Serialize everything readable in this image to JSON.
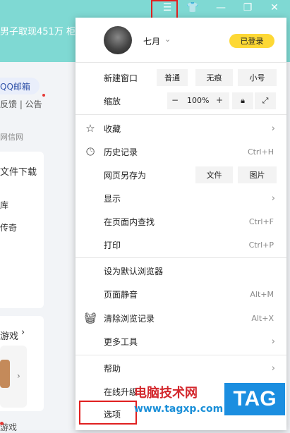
{
  "titlebar": {
    "menu_icon": "hamburger-icon",
    "skin_icon": "shirt-icon",
    "minimize_icon": "minimize-icon",
    "restore_icon": "restore-icon",
    "close_icon": "close-icon"
  },
  "background": {
    "banner_text": "男子取现451万 柜",
    "mail_chip": "QQ邮箱",
    "links": "反馈 | 公告",
    "net_label": "网信网",
    "download_heading": "文件下载",
    "item1": "库",
    "item2": "传奇",
    "games_heading": "游戏",
    "games_footer": "游戏"
  },
  "menu": {
    "user": {
      "name": "七月",
      "status_button": "已登录"
    },
    "new_window": {
      "label": "新建窗口",
      "options": [
        "普通",
        "无痕",
        "小号"
      ]
    },
    "zoom": {
      "label": "缩放",
      "minus": "−",
      "value": "100%",
      "plus": "+"
    },
    "items": {
      "favorites": "收藏",
      "history": "历史记录",
      "history_shortcut": "Ctrl+H",
      "save_as": "网页另存为",
      "save_file": "文件",
      "save_image": "图片",
      "display": "显示",
      "find": "在页面内查找",
      "find_shortcut": "Ctrl+F",
      "print": "打印",
      "print_shortcut": "Ctrl+P",
      "default_browser": "设为默认浏览器",
      "mute": "页面静音",
      "mute_shortcut": "Alt+M",
      "clear": "清除浏览记录",
      "clear_shortcut": "Alt+X",
      "more_tools": "更多工具",
      "help": "帮助",
      "online_upgrade": "在线升级",
      "options": "选项"
    }
  },
  "watermark": {
    "line1": "电脑技术网",
    "line2": "www.tagxp.com",
    "logo": "TAG"
  },
  "colors": {
    "accent_teal": "#7fd9d3",
    "login_yellow": "#fdd835",
    "highlight_red": "#e02020"
  }
}
